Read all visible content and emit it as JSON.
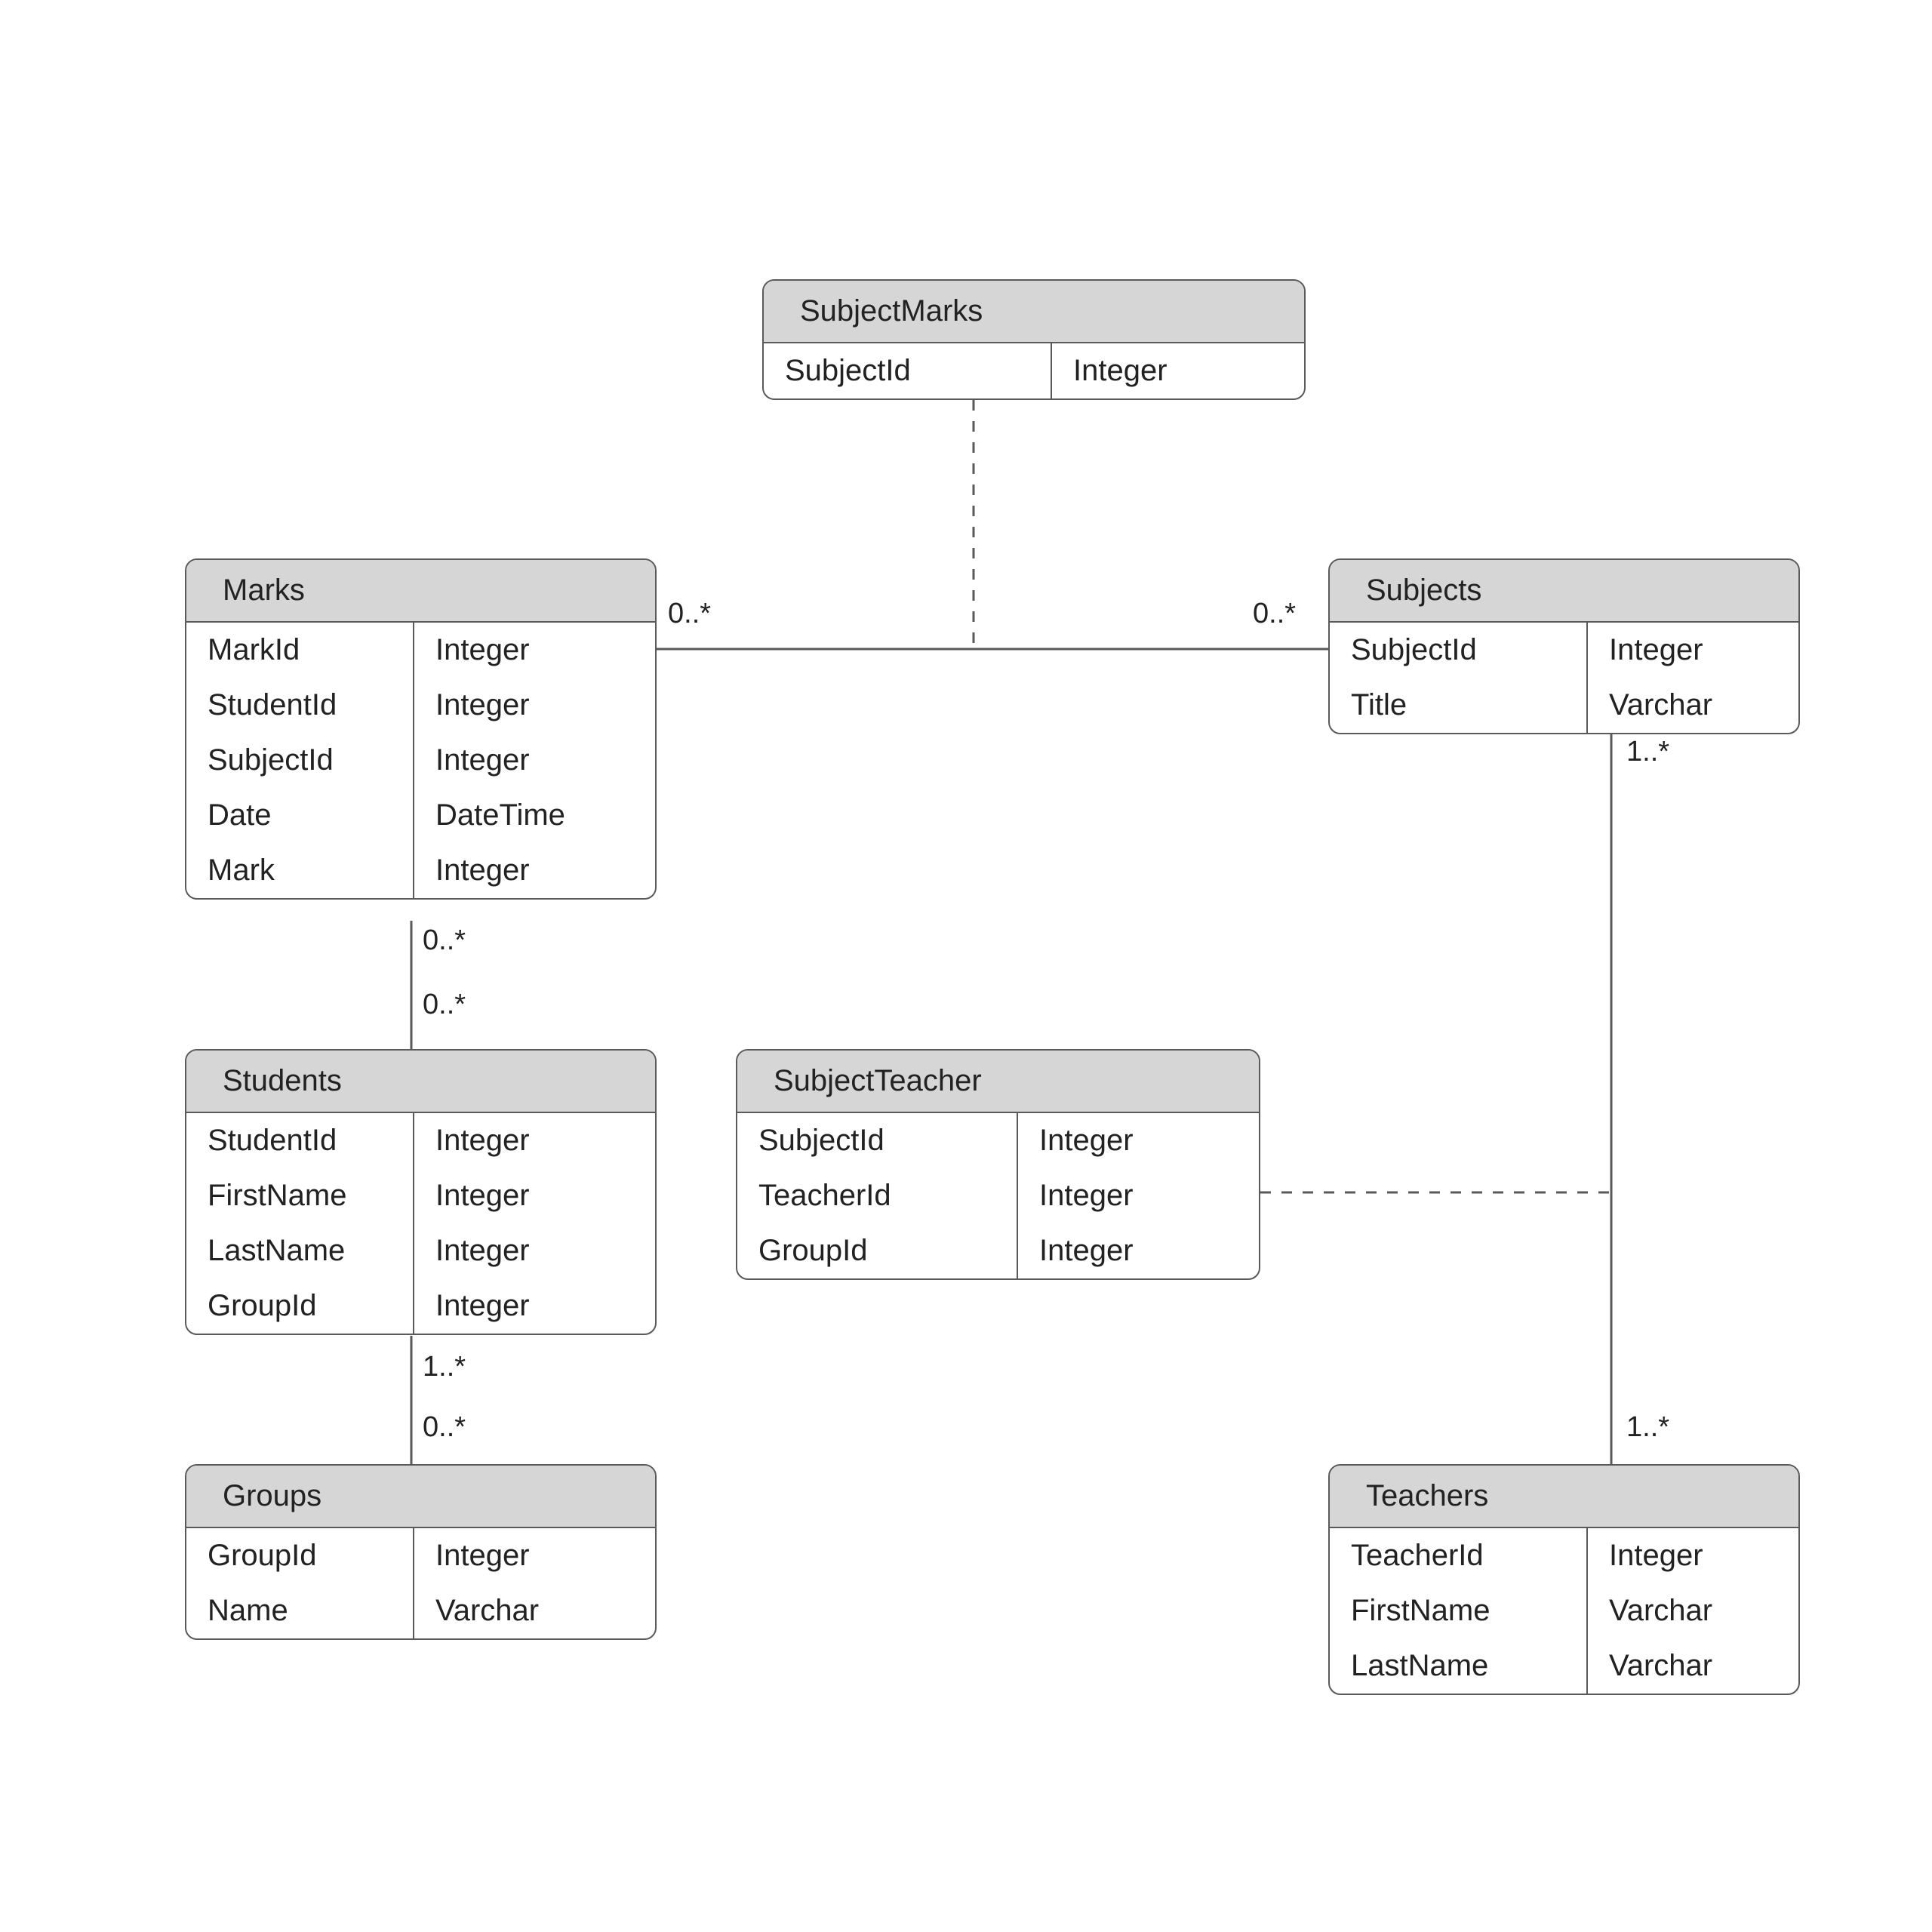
{
  "entities": {
    "subjectMarks": {
      "title": "SubjectMarks",
      "rows": [
        {
          "name": "SubjectId",
          "type": "Integer"
        }
      ]
    },
    "marks": {
      "title": "Marks",
      "rows": [
        {
          "name": "MarkId",
          "type": "Integer"
        },
        {
          "name": "StudentId",
          "type": "Integer"
        },
        {
          "name": "SubjectId",
          "type": "Integer"
        },
        {
          "name": "Date",
          "type": "DateTime"
        },
        {
          "name": "Mark",
          "type": "Integer"
        }
      ]
    },
    "subjects": {
      "title": "Subjects",
      "rows": [
        {
          "name": "SubjectId",
          "type": "Integer"
        },
        {
          "name": "Title",
          "type": "Varchar"
        }
      ]
    },
    "students": {
      "title": "Students",
      "rows": [
        {
          "name": "StudentId",
          "type": "Integer"
        },
        {
          "name": "FirstName",
          "type": "Integer"
        },
        {
          "name": "LastName",
          "type": "Integer"
        },
        {
          "name": "GroupId",
          "type": "Integer"
        }
      ]
    },
    "subjectTeacher": {
      "title": "SubjectTeacher",
      "rows": [
        {
          "name": "SubjectId",
          "type": "Integer"
        },
        {
          "name": "TeacherId",
          "type": "Integer"
        },
        {
          "name": "GroupId",
          "type": "Integer"
        }
      ]
    },
    "groups": {
      "title": "Groups",
      "rows": [
        {
          "name": "GroupId",
          "type": "Integer"
        },
        {
          "name": "Name",
          "type": "Varchar"
        }
      ]
    },
    "teachers": {
      "title": "Teachers",
      "rows": [
        {
          "name": "TeacherId",
          "type": "Integer"
        },
        {
          "name": "FirstName",
          "type": "Varchar"
        },
        {
          "name": "LastName",
          "type": "Varchar"
        }
      ]
    }
  },
  "multiplicities": {
    "marks_right": "0..*",
    "subjects_left": "0..*",
    "marks_bottom": "0..*",
    "students_top": "0..*",
    "students_bottom": "1..*",
    "groups_top": "0..*",
    "subjects_bottom": "1..*",
    "teachers_top": "1..*"
  }
}
